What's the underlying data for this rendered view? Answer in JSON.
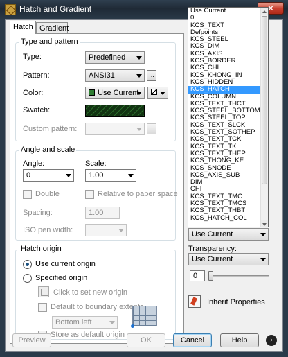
{
  "window": {
    "title": "Hatch and Gradient",
    "close_glyph": "✕"
  },
  "tabs": [
    {
      "label": "Hatch"
    },
    {
      "label": "Gradient"
    }
  ],
  "type_pattern": {
    "title": "Type and pattern",
    "type_label": "Type:",
    "type_value": "Predefined",
    "pattern_label": "Pattern:",
    "pattern_value": "ANSI31",
    "browse_label": "...",
    "color_label": "Color:",
    "color_value": "Use Current",
    "swatch_label": "Swatch:",
    "custom_label": "Custom pattern:",
    "custom_browse_label": "..."
  },
  "angle_scale": {
    "title": "Angle and scale",
    "angle_label": "Angle:",
    "angle_value": "0",
    "scale_label": "Scale:",
    "scale_value": "1.00",
    "double_label": "Double",
    "relative_label": "Relative to paper space",
    "spacing_label": "Spacing:",
    "spacing_value": "1.00",
    "iso_label": "ISO pen width:"
  },
  "hatch_origin": {
    "title": "Hatch origin",
    "use_current_label": "Use current origin",
    "specified_label": "Specified origin",
    "click_set_label": "Click to set new origin",
    "default_extents_label": "Default to boundary extents",
    "position_value": "Bottom left",
    "store_default_label": "Store as default origin"
  },
  "right_panel": {
    "layer_value": "Use Current",
    "transparency_label": "Transparency:",
    "transparency_value": "Use Current",
    "transparency_number": "0",
    "inherit_label": "Inherit Properties"
  },
  "dropdown": {
    "selected": "KCS_HATCH",
    "items": [
      "Use Current",
      "0",
      "KCS_TEXT",
      "Defpoints",
      "KCS_STEEL",
      "KCS_DIM",
      "KCS_AXIS",
      "KCS_BORDER",
      "KCS_CHI",
      "KCS_KHONG_IN",
      "KCS_HIDDEN",
      "KCS_HATCH",
      "KCS_COLUMN",
      "KCS_TEXT_THCT",
      "KCS_STEEL_BOTTOM",
      "KCS_STEEL_TOP",
      "KCS_TEXT_SLCK",
      "KCS_TEXT_SOTHEP",
      "KCS_TEXT_TCK",
      "KCS_TEXT_TK",
      "KCS_TEXT_THEP",
      "KCS_THONG_KE",
      "KCS_SNODE",
      "KCS_AXIS_SUB",
      "DIM",
      "CHI",
      "KCS_TEXT_TMC",
      "KCS_TEXT_TMCS",
      "KCS_TEXT_THBT",
      "KCS_HATCH_COL"
    ]
  },
  "buttons": {
    "preview": "Preview",
    "ok": "OK",
    "cancel": "Cancel",
    "help": "Help",
    "more": "›"
  }
}
